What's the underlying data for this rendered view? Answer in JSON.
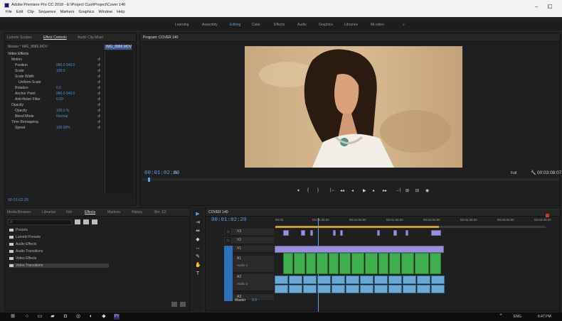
{
  "window": {
    "title": "Adobe Premiere Pro CC 2018 - E:\\Project Cuoi\\Project\\Cover 140",
    "menu": [
      "File",
      "Edit",
      "Clip",
      "Sequence",
      "Markers",
      "Graphics",
      "Window",
      "Help"
    ],
    "controls": [
      "–",
      "⧠"
    ]
  },
  "workspaces": {
    "items": [
      "Learning",
      "Assembly",
      "Editing",
      "Color",
      "Effects",
      "Audio",
      "Graphics",
      "Libraries",
      "Mr.video"
    ],
    "active": "Editing",
    "more": "»"
  },
  "source_panel": {
    "tabs": [
      "Lumetri Scopes",
      "Effect Controls",
      "Audio Clip Mixer"
    ],
    "master": "Master * IMG_8886.MOV",
    "clip_label": "IMG_8886.MOV",
    "section": "Video Effects",
    "effects": [
      {
        "name": "Motion",
        "indent": 1
      },
      {
        "name": "Position",
        "value": "960.0   540.0",
        "indent": 2
      },
      {
        "name": "Scale",
        "value": "100.0",
        "indent": 2
      },
      {
        "name": "Scale Width",
        "value": "",
        "indent": 2
      },
      {
        "name": "Uniform Scale",
        "value": "",
        "indent": 3
      },
      {
        "name": "Rotation",
        "value": "0.0",
        "indent": 2
      },
      {
        "name": "Anchor Point",
        "value": "960.0   540.0",
        "indent": 2
      },
      {
        "name": "Anti-flicker Filter",
        "value": "0.00",
        "indent": 2
      },
      {
        "name": "Opacity",
        "indent": 1
      },
      {
        "name": "Opacity",
        "value": "100.0 %",
        "indent": 2
      },
      {
        "name": "Blend Mode",
        "value": "Normal",
        "indent": 2
      },
      {
        "name": "Time Remapping",
        "indent": 1
      },
      {
        "name": "Speed",
        "value": "100.00%",
        "indent": 2
      }
    ],
    "timecode": "00:01:02:20"
  },
  "program_monitor": {
    "tab": "Program: COVER 140",
    "timecode": "00:01:02:20",
    "fit": "Fit",
    "resolution": "Full",
    "duration": "00:03:08:07",
    "controls": [
      "▾",
      "{",
      "}",
      "|←",
      "◂◂",
      "◂",
      "▶",
      "▸",
      "▸▸",
      "→|",
      "⊞",
      "⊟",
      "◉",
      "⧉",
      "+"
    ]
  },
  "project_panel": {
    "tabs": [
      "Media Browser",
      "Libraries",
      "Info",
      "Effects",
      "Markers",
      "History",
      "Bin: 1/2"
    ],
    "active_tab": "Effects",
    "search_placeholder": "",
    "folders": [
      "Presets",
      "Lumetri Presets",
      "Audio Effects",
      "Audio Transitions",
      "Video Effects",
      "Video Transitions"
    ],
    "selected": "Video Transitions"
  },
  "timeline": {
    "tab": "COVER 140",
    "timecode": "00:01:02:20",
    "ruler": [
      "00:00",
      "00:00:30:00",
      "00:01:00:00",
      "00:01:30:00",
      "00:02:00:00",
      "00:02:30:00",
      "00:03:00:00",
      "00:03:30:00"
    ],
    "tracks": [
      "V3",
      "V2",
      "V1",
      "A1",
      "A2",
      "A3"
    ],
    "track_labels": {
      "a1": "Audio 1",
      "a2": "Audio 2"
    },
    "master": "Master",
    "master_value": "0.0"
  },
  "taskbar": {
    "time": "6:47 PM",
    "date": "",
    "lang": "ENG"
  }
}
